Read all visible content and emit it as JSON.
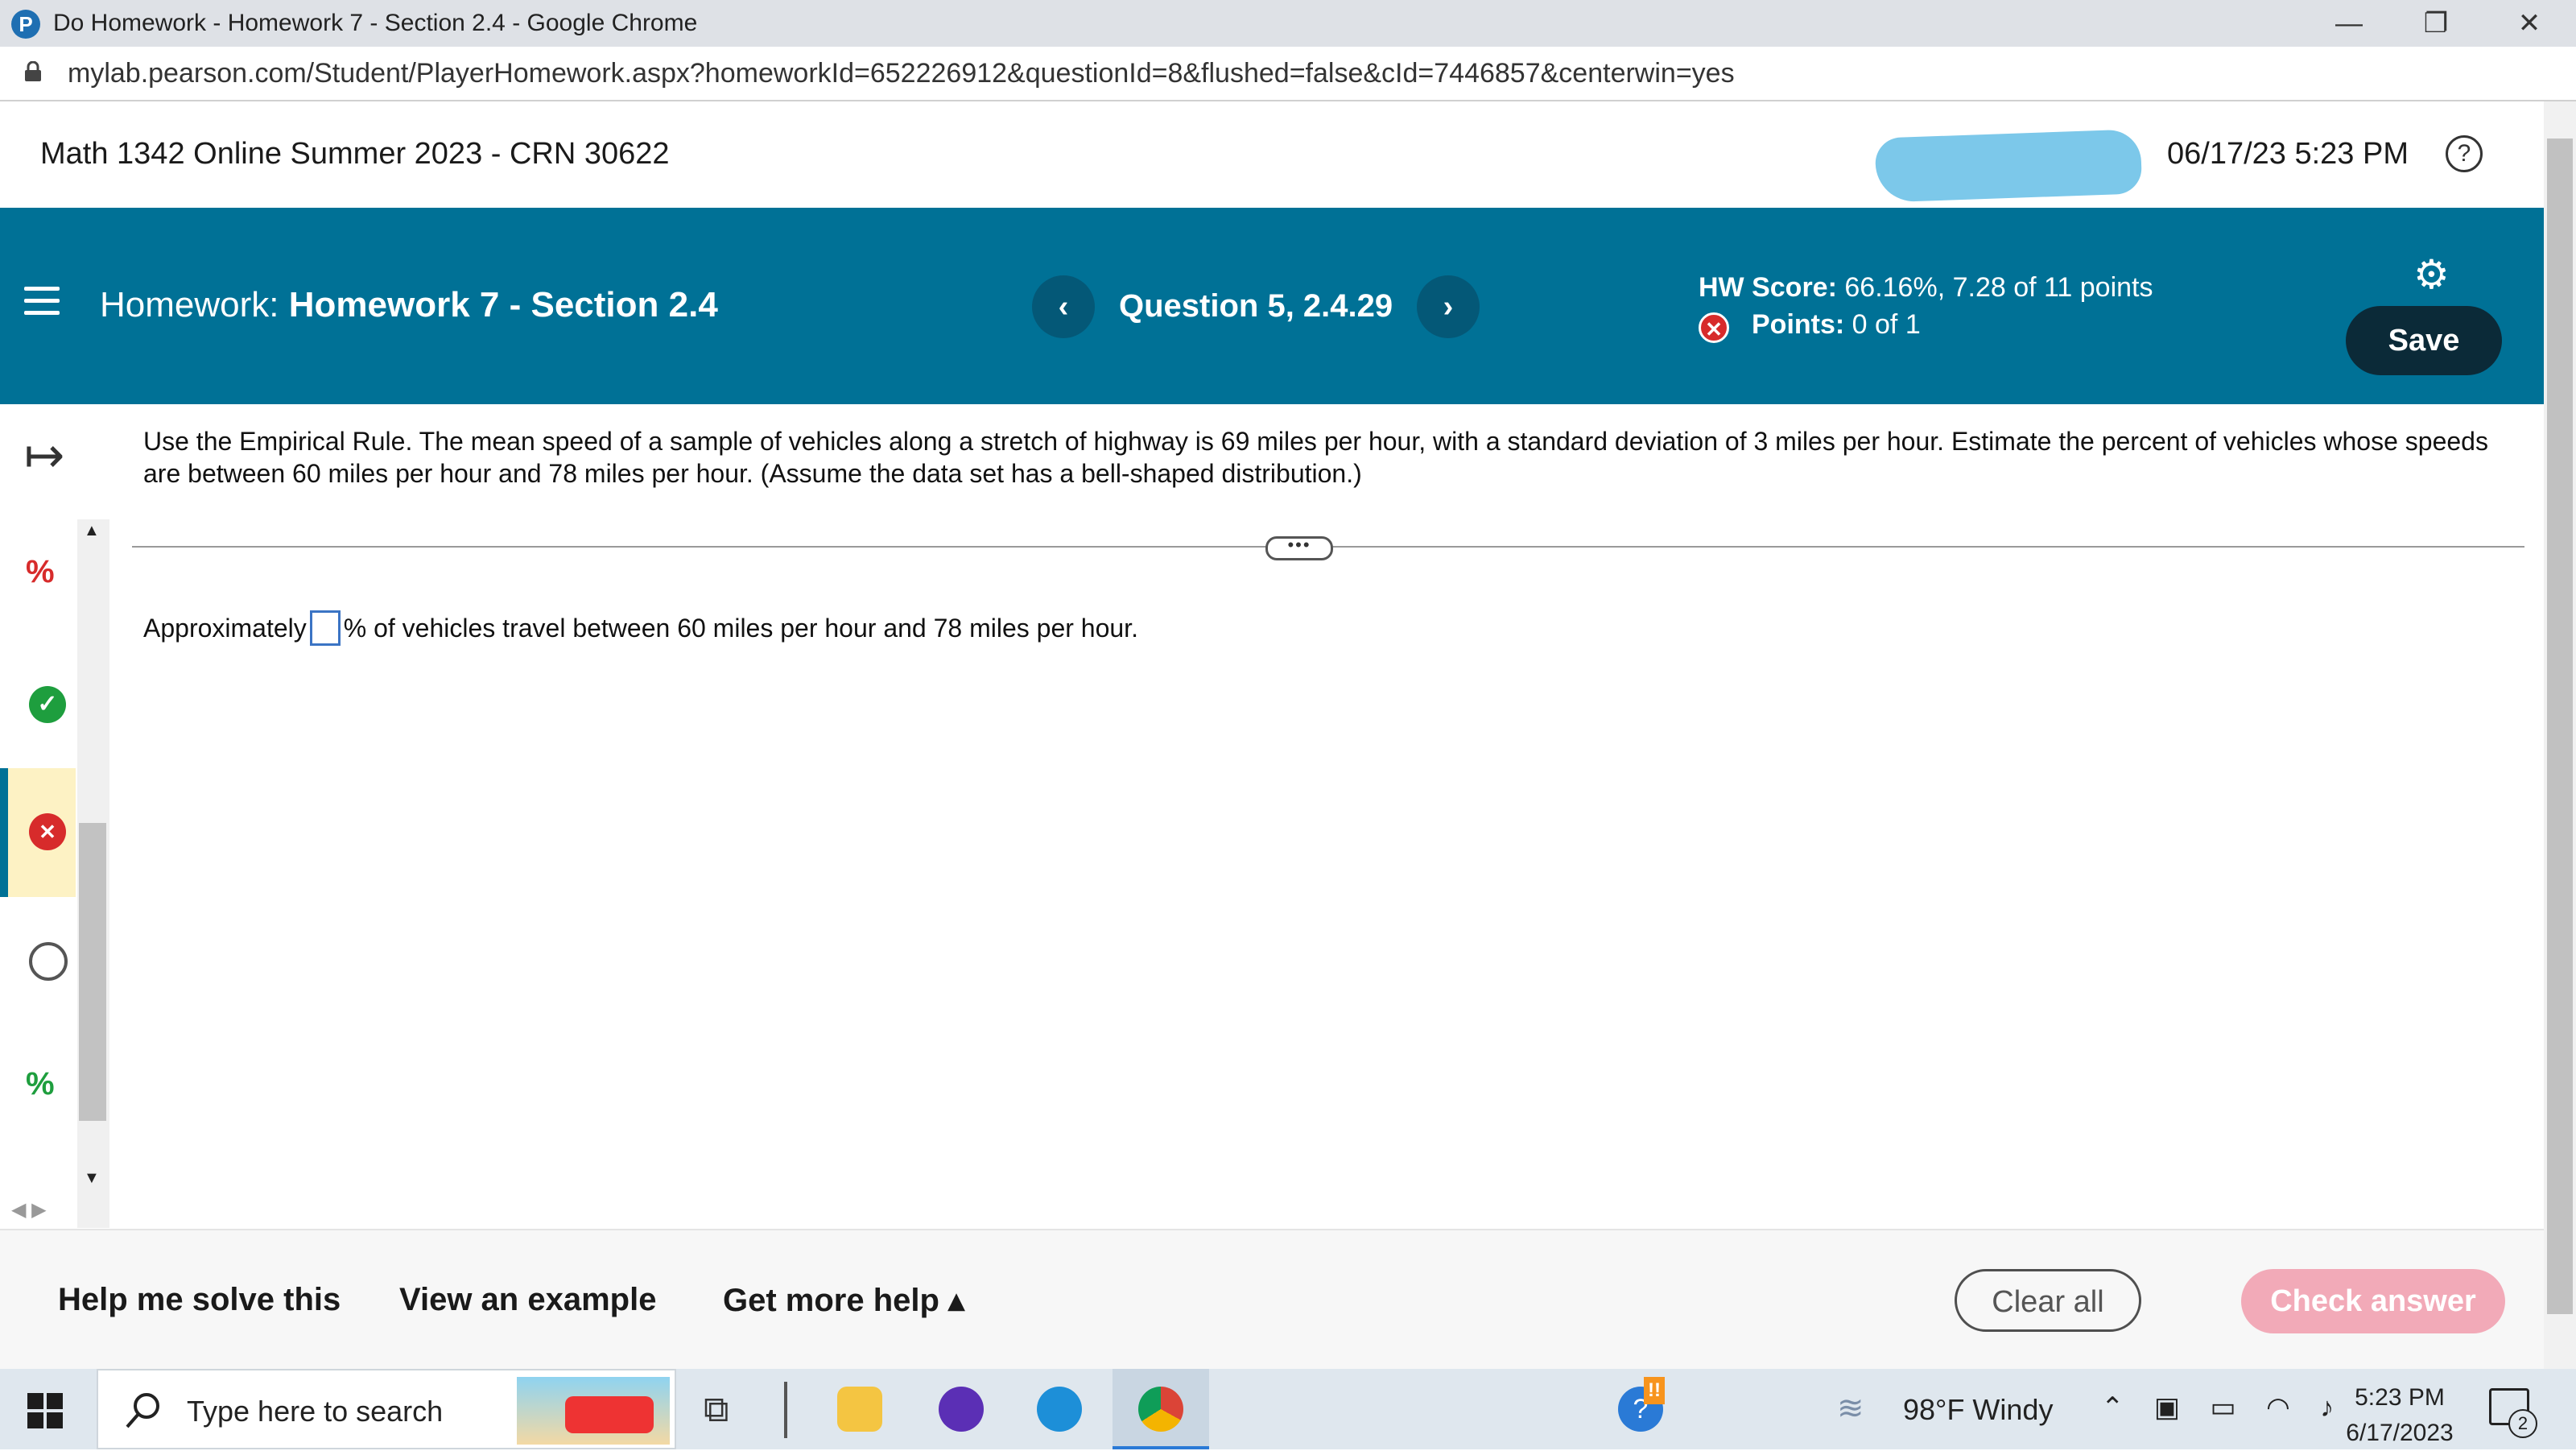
{
  "browser": {
    "window_title": "Do Homework - Homework 7 - Section 2.4 - Google Chrome",
    "favicon_letter": "P",
    "url": "mylab.pearson.com/Student/PlayerHomework.aspx?homeworkId=652226912&questionId=8&flushed=false&cId=7446857&centerwin=yes",
    "minimize": "—",
    "restore": "❐",
    "close": "✕"
  },
  "header": {
    "course": "Math 1342 Online Summer 2023 - CRN 30622",
    "datetime": "06/17/23 5:23 PM",
    "help": "?"
  },
  "hwbar": {
    "homework_prefix": "Homework:",
    "homework_name": "Homework 7 - Section 2.4",
    "prev": "‹",
    "question": "Question 5, 2.4.29",
    "next": "›",
    "hw_score_label": "HW Score:",
    "hw_score_value": "66.16%, 7.28 of 11 points",
    "points_label": "Points:",
    "points_value": "0 of 1",
    "save": "Save"
  },
  "rail": {
    "expand": "↦",
    "items": [
      {
        "status": "partial",
        "icon": "partial-credit-icon"
      },
      {
        "status": "correct",
        "icon": "check-icon"
      },
      {
        "status": "incorrect",
        "icon": "x-icon"
      },
      {
        "status": "unanswered",
        "icon": "circle-icon"
      },
      {
        "status": "partial",
        "icon": "partial-credit-icon"
      }
    ]
  },
  "question": {
    "text": "Use the Empirical Rule. The mean speed of a sample of vehicles along a stretch of highway is 69 miles per hour, with a standard deviation of 3 miles per hour. Estimate the percent of vehicles whose speeds are between 60 miles per hour and 78 miles per hour. (Assume the data set has a bell-shaped distribution.)",
    "more": "•••",
    "answer_prefix": "Approximately",
    "answer_value": "",
    "answer_suffix": "% of vehicles travel between 60 miles per hour and 78 miles per hour."
  },
  "footer": {
    "help_solve": "Help me solve this",
    "view_example": "View an example",
    "more_help": "Get more help ▴",
    "clear_all": "Clear all",
    "check_answer": "Check answer"
  },
  "taskbar": {
    "search_placeholder": "Type here to search",
    "weather": "98°F  Windy",
    "time": "5:23 PM",
    "date": "6/17/2023",
    "notification_count": "2"
  },
  "colors": {
    "teal": "#007196",
    "save_bg": "#0b2a38",
    "check_answer_bg": "#f2aab8",
    "incorrect_red": "#d72b2b",
    "correct_green": "#1e9e3e",
    "selected_bg": "#fdf2c4"
  }
}
